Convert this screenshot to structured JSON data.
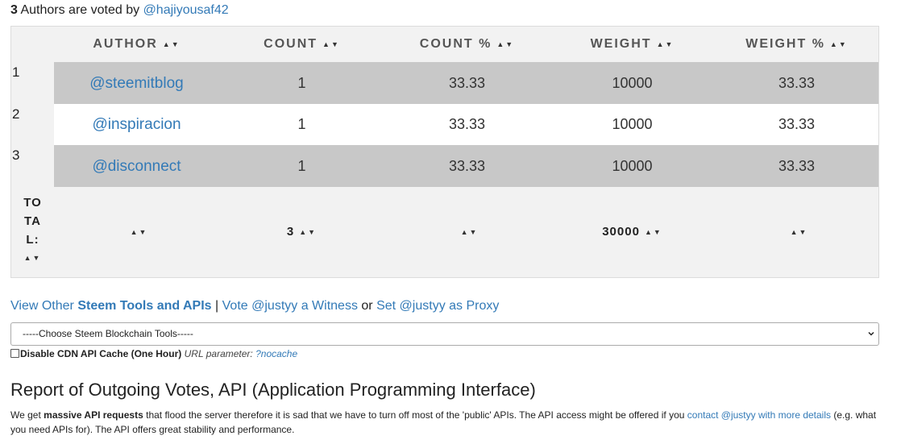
{
  "summary": {
    "count": "3",
    "text": "Authors are voted by",
    "user": "@hajiyousaf42"
  },
  "table": {
    "headers": [
      "AUTHOR",
      "COUNT",
      "COUNT %",
      "WEIGHT",
      "WEIGHT %"
    ],
    "sort_glyph": "▲▼",
    "rows": [
      {
        "index": "1",
        "author": "@steemitblog",
        "count": "1",
        "count_pct": "33.33",
        "weight": "10000",
        "weight_pct": "33.33"
      },
      {
        "index": "2",
        "author": "@inspiracion",
        "count": "1",
        "count_pct": "33.33",
        "weight": "10000",
        "weight_pct": "33.33"
      },
      {
        "index": "3",
        "author": "@disconnect",
        "count": "1",
        "count_pct": "33.33",
        "weight": "10000",
        "weight_pct": "33.33"
      }
    ],
    "footer": {
      "label_lines": [
        "TO",
        "TA",
        "L:"
      ],
      "author": "",
      "count": "3",
      "count_pct": "",
      "weight": "30000",
      "weight_pct": ""
    }
  },
  "links": {
    "view_other": "View Other",
    "steem_tools": "Steem Tools and APIs",
    "sep": "|",
    "vote_witness": "Vote @justyy a Witness",
    "or": "or",
    "set_proxy": "Set @justyy as Proxy"
  },
  "tools_select": {
    "selected": "-----Choose Steem Blockchain Tools-----"
  },
  "cdn": {
    "label": "Disable CDN API Cache (One Hour)",
    "param_label": "URL parameter:",
    "param_value": "?nocache"
  },
  "report": {
    "title": "Report of Outgoing Votes, API (Application Programming Interface)",
    "p1_a": "We get",
    "p1_bold": "massive API requests",
    "p1_b": "that flood the server therefore it is sad that we have to turn off most of the 'public' APIs. The API access might be offered if you",
    "p1_link": "contact @justyy with more details",
    "p1_c": "(e.g. what you need APIs for). The API offers great stability and performance."
  },
  "colors": {
    "link": "#337ab7",
    "row_shade": "#c8c8c8",
    "table_bg": "#f2f2f2"
  }
}
